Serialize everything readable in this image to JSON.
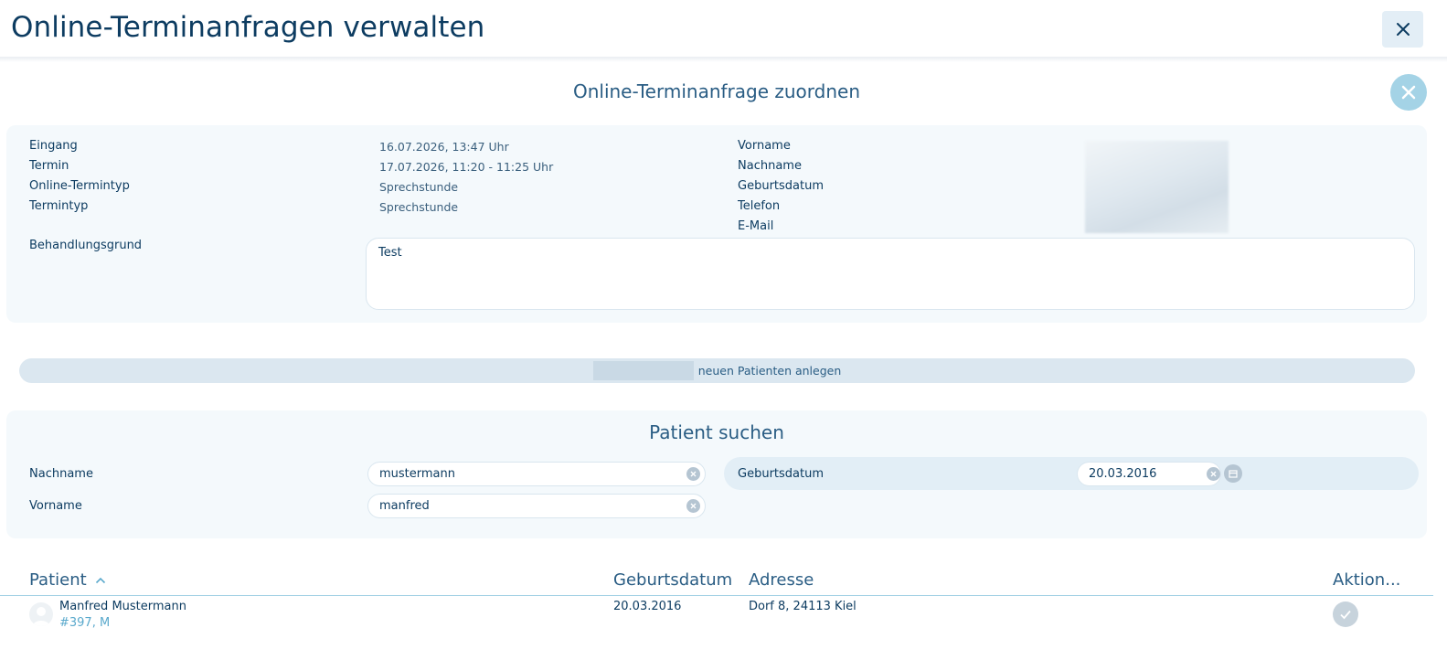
{
  "window": {
    "title": "Online-Terminanfragen verwalten"
  },
  "dialog": {
    "title": "Online-Terminanfrage zuordnen"
  },
  "request": {
    "labels": {
      "eingang": "Eingang",
      "termin": "Termin",
      "online_termintyp": "Online-Termintyp",
      "termintyp": "Termintyp",
      "behandlungsgrund": "Behandlungsgrund",
      "vorname": "Vorname",
      "nachname": "Nachname",
      "geburtsdatum": "Geburtsdatum",
      "telefon": "Telefon",
      "email": "E-Mail"
    },
    "values": {
      "eingang": "16.07.2026, 13:47 Uhr",
      "termin": "17.07.2026, 11:20 - 11:25 Uhr",
      "online_termintyp": "Sprechstunde",
      "termintyp": "Sprechstunde",
      "behandlungsgrund": "Test"
    }
  },
  "new_patient": {
    "label": "neuen Patienten anlegen"
  },
  "search": {
    "title": "Patient suchen",
    "nachname_label": "Nachname",
    "nachname_value": "mustermann",
    "vorname_label": "Vorname",
    "vorname_value": "manfred",
    "geburtsdatum_label": "Geburtsdatum",
    "geburtsdatum_value": "20.03.2016"
  },
  "results": {
    "headers": {
      "patient": "Patient",
      "geburtsdatum": "Geburtsdatum",
      "adresse": "Adresse",
      "aktion": "Aktion..."
    },
    "sort_indicator": "^",
    "rows": [
      {
        "name": "Manfred Mustermann",
        "sub": "#397, M",
        "geburtsdatum": "20.03.2016",
        "adresse": "Dorf 8, 24113 Kiel"
      }
    ]
  },
  "colors": {
    "primary_text": "#0d3c61",
    "accent_light": "#a4d3e6",
    "panel_bg": "#f4f9fc",
    "table_line": "#9fcfe3"
  },
  "icons": {
    "window_close": "close-icon",
    "dialog_close": "close-circle-icon",
    "field_clear": "clear-icon",
    "calendar": "calendar-icon",
    "sort": "chevron-up-icon",
    "avatar": "person-avatar-icon",
    "action": "checkmark-icon"
  }
}
